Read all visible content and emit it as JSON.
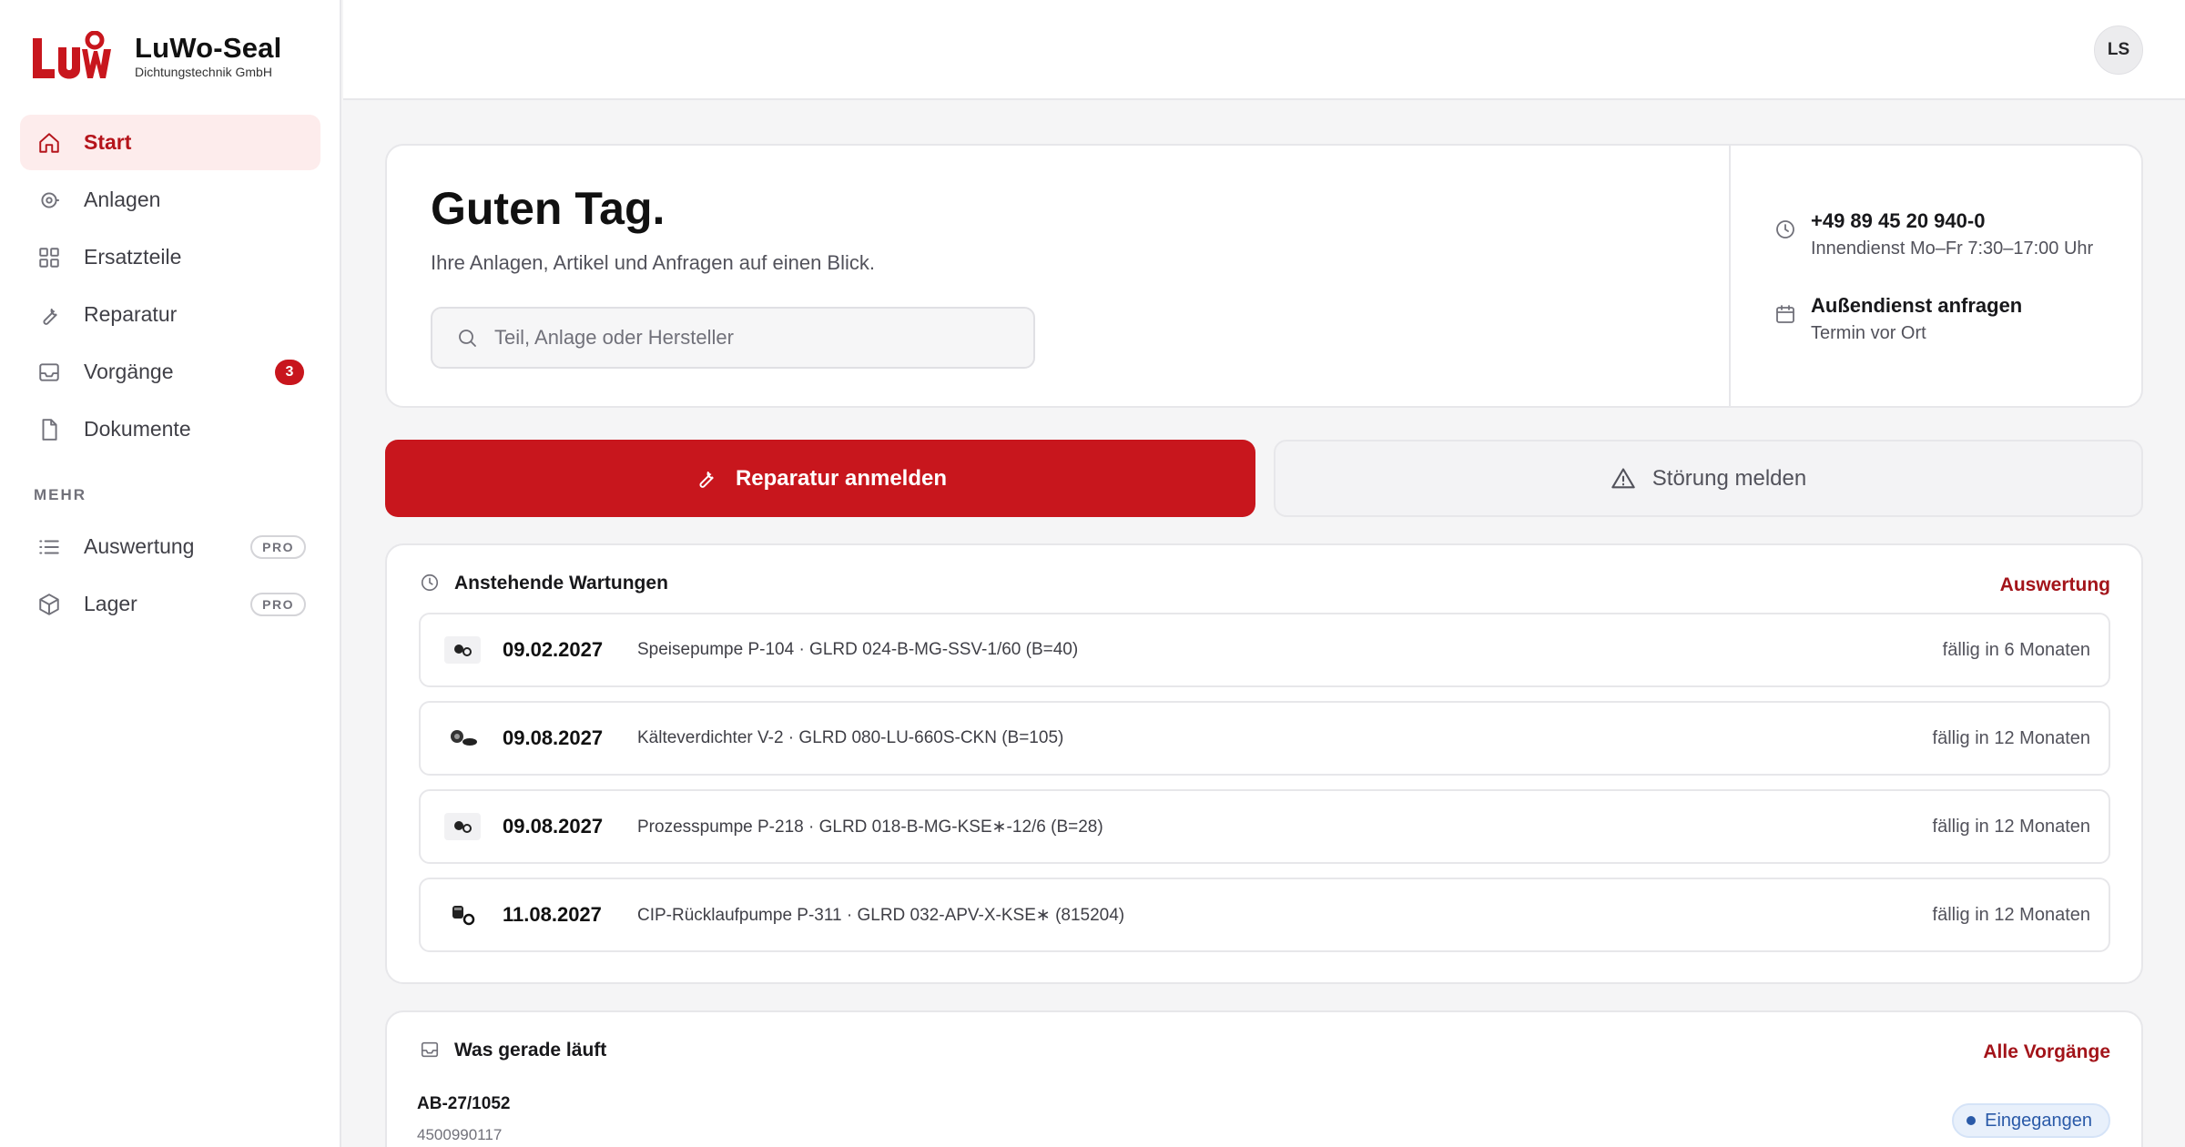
{
  "brand": {
    "name": "LuWo-Seal",
    "subtitle": "Dichtungstechnik GmbH",
    "logo_text": "LuWo",
    "brand_color": "#c8161d"
  },
  "sidebar": {
    "items": [
      {
        "label": "Start",
        "icon": "home-icon",
        "active": true
      },
      {
        "label": "Anlagen",
        "icon": "plant-icon"
      },
      {
        "label": "Ersatzteile",
        "icon": "grid-icon"
      },
      {
        "label": "Reparatur",
        "icon": "wrench-icon"
      },
      {
        "label": "Vorgänge",
        "icon": "inbox-icon",
        "badge": "3"
      },
      {
        "label": "Dokumente",
        "icon": "document-icon"
      }
    ],
    "section_label": "MEHR",
    "more_items": [
      {
        "label": "Auswertung",
        "icon": "list-icon",
        "badge": "PRO"
      },
      {
        "label": "Lager",
        "icon": "box-icon",
        "badge": "PRO"
      }
    ]
  },
  "header": {
    "avatar_initials": "LS"
  },
  "hero": {
    "title": "Guten Tag.",
    "subtitle": "Ihre Anlagen, Artikel und Anfragen auf einen Blick.",
    "search_placeholder": "Teil, Anlage oder Hersteller",
    "contact": [
      {
        "title": "+49 89 45 20 940-0",
        "subtitle": "Innendienst Mo–Fr 7:30–17:00 Uhr",
        "icon": "clock-icon"
      },
      {
        "title": "Außendienst anfragen",
        "subtitle": "Termin vor Ort",
        "icon": "calendar-icon"
      }
    ]
  },
  "actions": {
    "primary_label": "Reparatur anmelden",
    "secondary_label": "Störung melden"
  },
  "maintenance": {
    "title": "Anstehende Wartungen",
    "link": "Auswertung",
    "rows": [
      {
        "date": "09.02.2027",
        "desc": "Speisepumpe P-104 · GLRD 024-B-MG-SSV-1/60 (B=40)",
        "due": "fällig in 6 Monaten"
      },
      {
        "date": "09.08.2027",
        "desc": "Kälteverdichter V-2 · GLRD 080-LU-660S-CKN (B=105)",
        "due": "fällig in 12 Monaten"
      },
      {
        "date": "09.08.2027",
        "desc": "Prozesspumpe P-218 · GLRD 018-B-MG-KSE∗-12/6 (B=28)",
        "due": "fällig in 12 Monaten"
      },
      {
        "date": "11.08.2027",
        "desc": "CIP-Rücklaufpumpe P-311 · GLRD 032-APV-X-KSE∗ (815204)",
        "due": "fällig in 12 Monaten"
      }
    ]
  },
  "running": {
    "title": "Was gerade läuft",
    "link": "Alle Vorgänge",
    "item": {
      "id": "AB-27/1052",
      "sub": "4500990117",
      "status": "Eingegangen",
      "status_color": "#2a5aa8"
    }
  }
}
